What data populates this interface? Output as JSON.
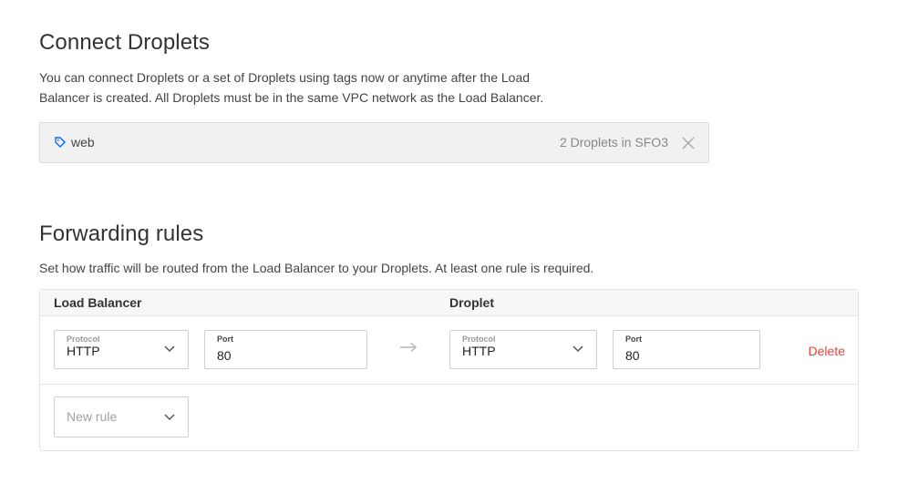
{
  "connect": {
    "title": "Connect Droplets",
    "description_line1": "You can connect Droplets or a set of Droplets using tags now or anytime after the Load",
    "description_line2": "Balancer is created. All Droplets must be in the same VPC network as the Load Balancer.",
    "tag": {
      "icon": "tag-icon",
      "label": "web",
      "count": "2 Droplets in SFO3",
      "remove_icon": "close-icon"
    }
  },
  "forwarding": {
    "title": "Forwarding rules",
    "description": "Set how traffic will be routed from the Load Balancer to your Droplets. At least one rule is required.",
    "columns": {
      "load_balancer": "Load Balancer",
      "droplet": "Droplet"
    },
    "rules": [
      {
        "lb_protocol_label": "Protocol",
        "lb_protocol": "HTTP",
        "lb_port_label": "Port",
        "lb_port": "80",
        "droplet_protocol_label": "Protocol",
        "droplet_protocol": "HTTP",
        "droplet_port_label": "Port",
        "droplet_port": "80",
        "delete_label": "Delete"
      }
    ],
    "new_rule_placeholder": "New rule"
  },
  "colors": {
    "delete": "#e0443b",
    "tag_icon": "#0069ff",
    "text": "#333333"
  }
}
